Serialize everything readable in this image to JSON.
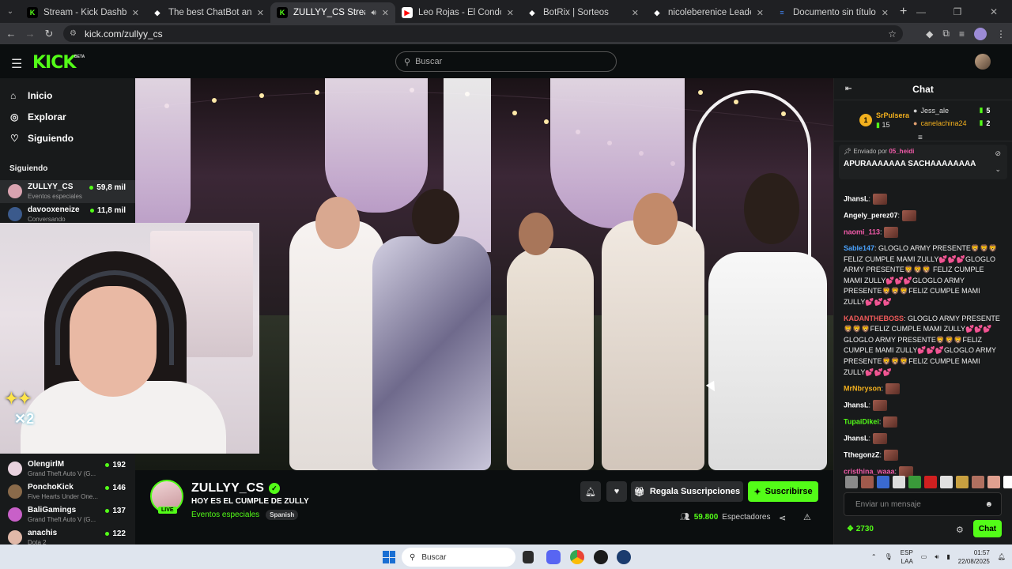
{
  "browser": {
    "tabs": [
      {
        "title": "Stream - Kick Dashboard",
        "icon": "kick-icon",
        "color": "#53fc18",
        "active": false
      },
      {
        "title": "The best ChatBot and Widgets",
        "icon": "botrix-icon",
        "color": "#ffffff",
        "active": false
      },
      {
        "title": "ZULLYY_CS Stream - Watch",
        "icon": "kick-icon",
        "color": "#53fc18",
        "active": true
      },
      {
        "title": "Leo Rojas - El Condor Pasa (Vid",
        "icon": "youtube-icon",
        "color": "#ff0000",
        "active": false
      },
      {
        "title": "BotRix | Sorteos",
        "icon": "botrix-icon",
        "color": "#ffffff",
        "active": false
      },
      {
        "title": "nicoleberenice LeaderBoard | T",
        "icon": "botrix-icon",
        "color": "#ffffff",
        "active": false
      },
      {
        "title": "Documento sin título - Docum",
        "icon": "docs-icon",
        "color": "#4285f4",
        "active": false
      }
    ],
    "url": "kick.com/zullyy_cs"
  },
  "header": {
    "logo": "KICK",
    "beta": "BETA",
    "search_placeholder": "Buscar"
  },
  "sidebar": {
    "nav": [
      {
        "label": "Inicio",
        "icon": "home-icon"
      },
      {
        "label": "Explorar",
        "icon": "compass-icon"
      },
      {
        "label": "Siguiendo",
        "icon": "heart-icon"
      }
    ],
    "following_title": "Siguiendo",
    "following": [
      {
        "name": "ZULLYY_CS",
        "category": "Eventos especiales",
        "viewers": "59,8 mil",
        "color": "#d9a3b0"
      },
      {
        "name": "davooxeneize",
        "category": "Conversando",
        "viewers": "11,8 mil",
        "color": "#3b5a8c"
      }
    ],
    "recommended": [
      {
        "name": "OlengirlM",
        "category": "Grand Theft Auto V (G...",
        "viewers": "192",
        "color": "#e8d2de"
      },
      {
        "name": "PonchoKick",
        "category": "Five Hearts Under One...",
        "viewers": "146",
        "color": "#8a6a4a"
      },
      {
        "name": "BaliGamings",
        "category": "Grand Theft Auto V (G...",
        "viewers": "137",
        "color": "#c860c8"
      },
      {
        "name": "anachis",
        "category": "Dota 2",
        "viewers": "122",
        "color": "#e0b8a8"
      }
    ]
  },
  "stream": {
    "channel": "ZULLYY_CS",
    "live": "LIVE",
    "title": "HOY ES EL CUMPLE DE ZULLY",
    "category": "Eventos especiales",
    "language": "Spanish",
    "gift_label": "Regala Suscripciones",
    "subscribe_label": "Suscribirse",
    "viewers": "59.800",
    "viewers_label": "Espectadores"
  },
  "chat": {
    "title": "Chat",
    "leaderboard": {
      "top": {
        "rank": "1",
        "name": "SrPulsera",
        "count": "15"
      },
      "others": [
        {
          "name": "Jess_ale",
          "count": "5"
        },
        {
          "name": "canelachina24",
          "count": "2"
        }
      ]
    },
    "pinned": {
      "by_label": "Enviado por",
      "by_user": "05_heidi",
      "message": "APURAAAAAAA SACHAAAAAAAA"
    },
    "messages": [
      {
        "user": "JhansL",
        "color": "#ffffff",
        "text": ""
      },
      {
        "user": "Angely_perez07",
        "color": "#ffffff",
        "text": ""
      },
      {
        "user": "naomi_113",
        "color": "#f05aa8",
        "text": ""
      },
      {
        "user": "Sable147",
        "color": "#4aa3ff",
        "text": "GLOGLO ARMY PRESENTE🦁🦁🦁 FELIZ CUMPLE MAMI ZULLY💕💕💕GLOGLO ARMY PRESENTE🦁🦁🦁 FELIZ CUMPLE MAMI ZULLY💕💕💕GLOGLO ARMY PRESENTE🦁🦁🦁FELIZ CUMPLE MAMI ZULLY💕💕💕"
      },
      {
        "user": "KADANTHEBOSS",
        "color": "#f05a5a",
        "text": "GLOGLO ARMY PRESENTE 🦁🦁🦁FELIZ CUMPLE MAMI ZULLY💕💕💕 GLOGLO ARMY PRESENTE🦁🦁🦁FELIZ CUMPLE MAMI ZULLY💕💕💕GLOGLO ARMY PRESENTE🦁🦁🦁FELIZ CUMPLE MAMI ZULLY💕💕💕"
      },
      {
        "user": "MrNbryson",
        "color": "#f2b01e",
        "text": ""
      },
      {
        "user": "JhansL",
        "color": "#ffffff",
        "text": ""
      },
      {
        "user": "TupaiDikei",
        "color": "#53fc18",
        "text": ""
      },
      {
        "user": "JhansL",
        "color": "#ffffff",
        "text": ""
      },
      {
        "user": "TthegonzZ",
        "color": "#ffffff",
        "text": ""
      },
      {
        "user": "cristhina_waaa",
        "color": "#f05aa8",
        "text": ""
      }
    ],
    "input_placeholder": "Enviar un mensaje",
    "points": "2730",
    "send_label": "Chat"
  },
  "taskbar": {
    "search_placeholder": "Buscar",
    "lang": "ESP",
    "lang2": "LAA",
    "time": "01:57",
    "date": "22/08/2025"
  }
}
